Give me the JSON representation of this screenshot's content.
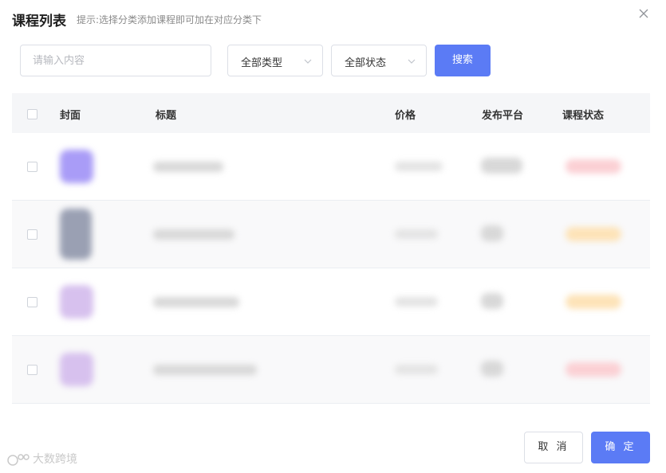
{
  "dialog": {
    "title": "课程列表",
    "hint": "提示:选择分类添加课程即可加在对应分类下"
  },
  "filters": {
    "search_placeholder": "请输入内容",
    "type_select": "全部类型",
    "status_select": "全部状态",
    "search_button": "搜索"
  },
  "table": {
    "columns": [
      "封面",
      "标题",
      "价格",
      "发布平台",
      "课程状态"
    ],
    "rows": [
      {
        "cover_color": "#a99cf7",
        "status_color": "#fbd0d4"
      },
      {
        "cover_color": "#9aa0b3",
        "status_color": "#fde3b8"
      },
      {
        "cover_color": "#d7c1ee",
        "status_color": "#fde3b8"
      },
      {
        "cover_color": "#d7c1ee",
        "status_color": "#fbd0d4"
      }
    ]
  },
  "footer": {
    "cancel_label": "取 消",
    "ok_label": "确 定"
  },
  "watermark": "大数跨境",
  "colors": {
    "accent": "#5b7bf5"
  }
}
